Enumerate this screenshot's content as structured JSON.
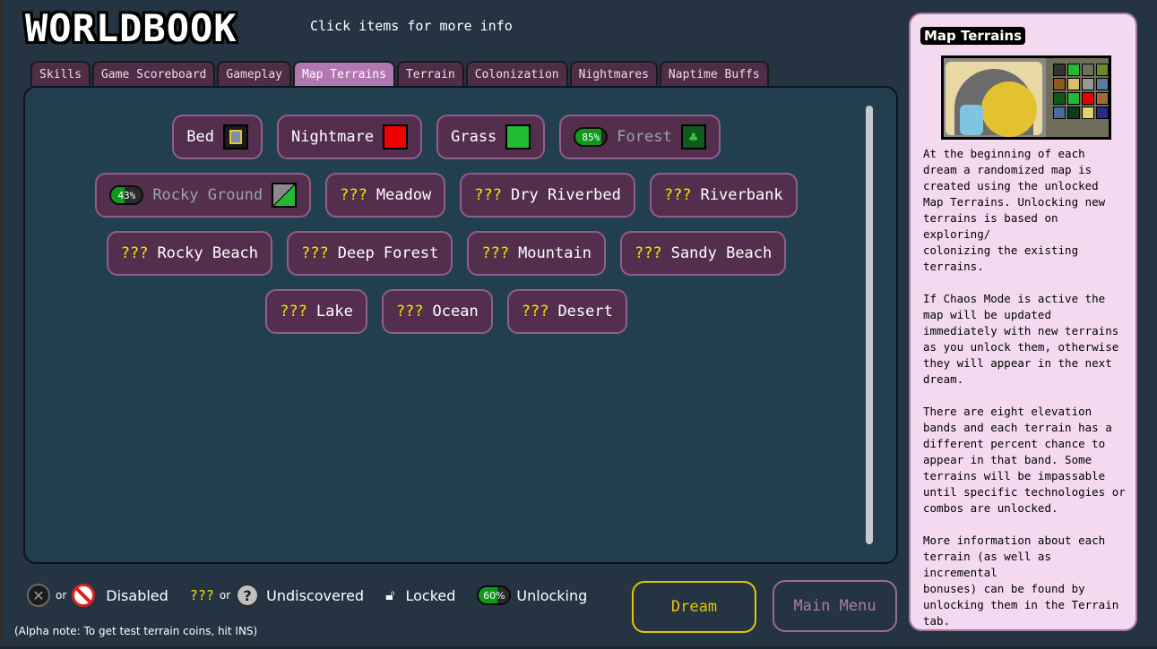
{
  "header": {
    "logo_text": "WORLDBOOK",
    "subtitle": "Click items for more info"
  },
  "tabs": [
    {
      "label": "Skills",
      "active": false
    },
    {
      "label": "Game Scoreboard",
      "active": false
    },
    {
      "label": "Gameplay",
      "active": false
    },
    {
      "label": "Map Terrains",
      "active": true
    },
    {
      "label": "Terrain",
      "active": false
    },
    {
      "label": "Colonization",
      "active": false
    },
    {
      "label": "Nightmares",
      "active": false
    },
    {
      "label": "Naptime Buffs",
      "active": false
    }
  ],
  "terrains": {
    "bed": {
      "label": "Bed",
      "icon": "bed-icon"
    },
    "nightmare": {
      "label": "Nightmare",
      "color": "#ee0000"
    },
    "grass": {
      "label": "Grass",
      "color": "#22bb33"
    },
    "forest": {
      "label": "Forest",
      "progress": "85%",
      "progress_value": 85,
      "icon": "tree-icon"
    },
    "rocky_ground": {
      "label": "Rocky Ground",
      "progress": "43%",
      "progress_value": 43
    },
    "meadow": {
      "prefix": "???",
      "label": "Meadow"
    },
    "dry_riverbed": {
      "prefix": "???",
      "label": "Dry Riverbed"
    },
    "riverbank": {
      "prefix": "???",
      "label": "Riverbank"
    },
    "rocky_beach": {
      "prefix": "???",
      "label": "Rocky Beach"
    },
    "deep_forest": {
      "prefix": "???",
      "label": "Deep Forest"
    },
    "mountain": {
      "prefix": "???",
      "label": "Mountain"
    },
    "sandy_beach": {
      "prefix": "???",
      "label": "Sandy Beach"
    },
    "lake": {
      "prefix": "???",
      "label": "Lake"
    },
    "ocean": {
      "prefix": "???",
      "label": "Ocean"
    },
    "desert": {
      "prefix": "???",
      "label": "Desert"
    }
  },
  "legend": {
    "or": "or",
    "disabled": "Disabled",
    "undiscovered_prefix": "???",
    "undiscovered": "Undiscovered",
    "locked": "Locked",
    "unlocking_pct": "60%",
    "unlocking_value": 60,
    "unlocking": "Unlocking"
  },
  "buttons": {
    "dream": "Dream",
    "main_menu": "Main Menu"
  },
  "alpha_note": "(Alpha note: To get test terrain coins, hit INS)",
  "info_panel": {
    "title": "Map Terrains",
    "text": "At the beginning of each\ndream a randomized map is\ncreated using the unlocked\nMap Terrains. Unlocking new\nterrains is based on exploring/\ncolonizing the existing terrains.\n\nIf Chaos Mode is active the\nmap will be updated\nimmediately with new terrains\nas you unlock them, otherwise\nthey will appear in the next\ndream.\n\nThere are eight elevation\nbands and each terrain has a\ndifferent percent chance to\nappear in that band. Some\nterrains will be impassable\nuntil specific technologies or\ncombos are unlocked.\n\nMore information about each\nterrain (as well as incremental\nbonuses) can be found by\nunlocking them in the Terrain\ntab."
  },
  "colors": {
    "accent_tab": "#b276b0",
    "item_bg": "#532f4d",
    "undiscovered": "#f4e500",
    "dream_button": "#e6c400"
  }
}
